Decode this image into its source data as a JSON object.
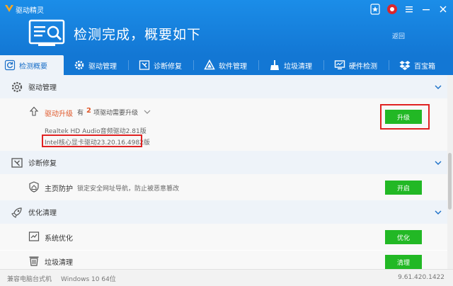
{
  "window": {
    "title": "驱动精灵"
  },
  "header": {
    "headline": "检测完成，概要如下",
    "back": "返回"
  },
  "tabs": [
    {
      "label": "检测概要",
      "icon": "refresh-icon"
    },
    {
      "label": "驱动管理",
      "icon": "gear-icon"
    },
    {
      "label": "诊断修复",
      "icon": "repair-icon"
    },
    {
      "label": "软件管理",
      "icon": "software-icon"
    },
    {
      "label": "垃圾清理",
      "icon": "broom-icon"
    },
    {
      "label": "硬件检测",
      "icon": "monitor-icon"
    },
    {
      "label": "百宝箱",
      "icon": "dropbox-icon"
    }
  ],
  "driver_section": {
    "title": "驱动管理",
    "upgrade_label": "驱动升级",
    "upgrade_pre": "有",
    "upgrade_count": "2",
    "upgrade_post": "项驱动需要升级",
    "driver1": "Realtek HD Audio音频驱动2.81版",
    "driver2": "Intel核心显卡驱动23.20.16.4982版",
    "upgrade_button": "升级"
  },
  "repair_section": {
    "title": "诊断修复",
    "item_label": "主页防护",
    "item_desc": "锁定安全网址导航，防止被恶意篡改",
    "item_button": "开启"
  },
  "clean_section": {
    "title": "优化清理",
    "optimize_label": "系统优化",
    "optimize_button": "优化",
    "clean_label": "垃圾清理",
    "clean_button": "清理"
  },
  "status": {
    "machine": "兼容电脑台式机",
    "os": "Windows 10 64位",
    "version": "9.61.420.1422"
  },
  "colors": {
    "header_blue": "#1b8de8",
    "accent_green": "#22b825",
    "highlight_red": "#e02222",
    "orange": "#e0582a"
  }
}
